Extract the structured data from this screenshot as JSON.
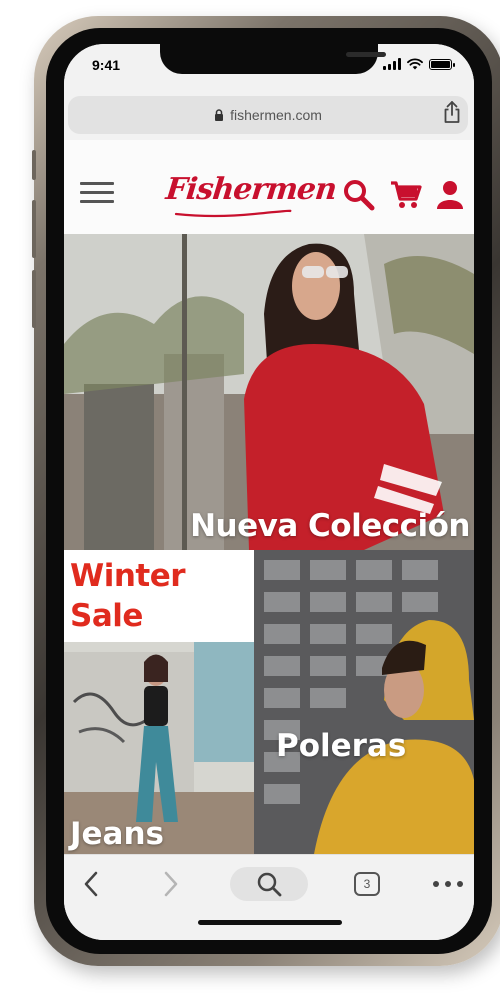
{
  "status_bar": {
    "time": "9:41"
  },
  "browser": {
    "url": "fishermen.com",
    "tab_count": "3"
  },
  "app": {
    "logo_text": "Fishermen",
    "brand_color": "#c8102e"
  },
  "tiles": {
    "hero_label": "Nueva Colección",
    "promo_line1": "Winter",
    "promo_line2": "Sale",
    "promo_color": "#e02b1e",
    "jeans_label": "Jeans",
    "poleras_label": "Poleras"
  },
  "icons": {
    "menu": "hamburger-icon",
    "search": "search-icon",
    "cart": "cart-icon",
    "user": "user-icon",
    "lock": "lock-icon",
    "share": "share-icon",
    "back": "chevron-left-icon",
    "forward": "chevron-right-icon",
    "more": "more-dots-icon"
  }
}
